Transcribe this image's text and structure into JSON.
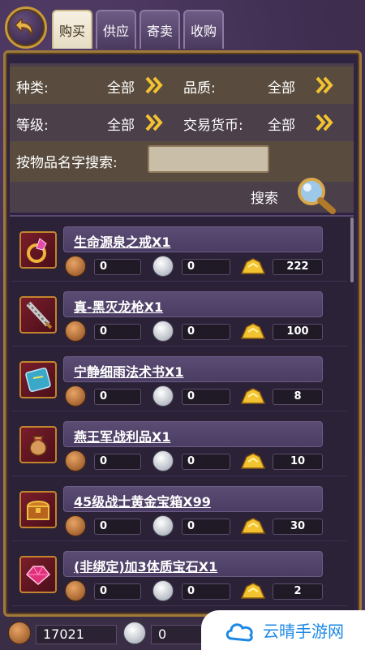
{
  "tabs": [
    {
      "label": "购买",
      "active": true
    },
    {
      "label": "供应",
      "active": false
    },
    {
      "label": "寄卖",
      "active": false
    },
    {
      "label": "收购",
      "active": false
    }
  ],
  "filters": {
    "category_label": "种类:",
    "category_value": "全部",
    "quality_label": "品质:",
    "quality_value": "全部",
    "level_label": "等级:",
    "level_value": "全部",
    "currency_label": "交易货币:",
    "currency_value": "全部",
    "name_search_label": "按物品名字搜索:",
    "name_search_value": "",
    "search_button_label": "搜索"
  },
  "items": [
    {
      "name": "生命源泉之戒X1",
      "bronze": "0",
      "silver": "0",
      "gold": "222",
      "icon": "ring-icon"
    },
    {
      "name": "真-黑灭龙枪X1",
      "bronze": "0",
      "silver": "0",
      "gold": "100",
      "icon": "spear-icon"
    },
    {
      "name": "宁静细雨法术书X1",
      "bronze": "0",
      "silver": "0",
      "gold": "8",
      "icon": "spellbook-icon"
    },
    {
      "name": "燕王军战利品X1",
      "bronze": "0",
      "silver": "0",
      "gold": "10",
      "icon": "loot-bag-icon"
    },
    {
      "name": "45级战士黄金宝箱X99",
      "bronze": "0",
      "silver": "0",
      "gold": "30",
      "icon": "treasure-chest-icon"
    },
    {
      "name": "(非绑定)加3体质宝石X1",
      "bronze": "0",
      "silver": "0",
      "gold": "2",
      "icon": "gem-icon"
    }
  ],
  "wallet": {
    "bronze": "17021",
    "silver": "0"
  },
  "watermark": {
    "text": "云晴手游网"
  },
  "colors": {
    "frame_gold": "#a07a3a",
    "panel_purple": "#2e2340",
    "link_blue": "#1e88e5"
  }
}
